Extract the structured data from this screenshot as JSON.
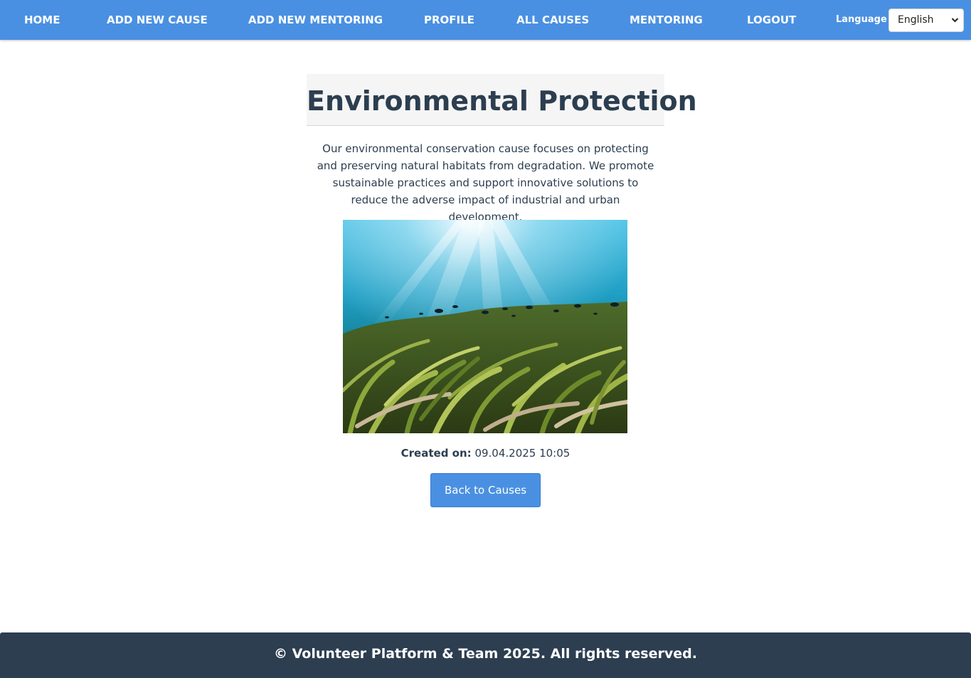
{
  "nav": {
    "home": "HOME",
    "add_new_cause": "ADD NEW CAUSE",
    "add_new_mentoring": "ADD NEW MENTORING",
    "profile": "PROFILE",
    "all_causes": "ALL CAUSES",
    "mentoring": "MENTORING",
    "logout": "LOGOUT",
    "language_label": "Language",
    "language_selected": "English"
  },
  "cause": {
    "title": "Environmental Protection",
    "description": "Our environmental conservation cause focuses on protecting and preserving natural habitats from degradation. We promote sustainable practices and support innovative solutions to reduce the adverse impact of industrial and urban development.",
    "created_label": "Created on:",
    "created_value": "09.04.2025 10:05",
    "back_button": "Back to Causes"
  },
  "footer": {
    "text": "© Volunteer Platform & Team 2025. All rights reserved."
  },
  "colors": {
    "navbar": "#4a90e2",
    "footer": "#2c3e50",
    "button": "#4a90e2",
    "text": "#2c3e50"
  }
}
